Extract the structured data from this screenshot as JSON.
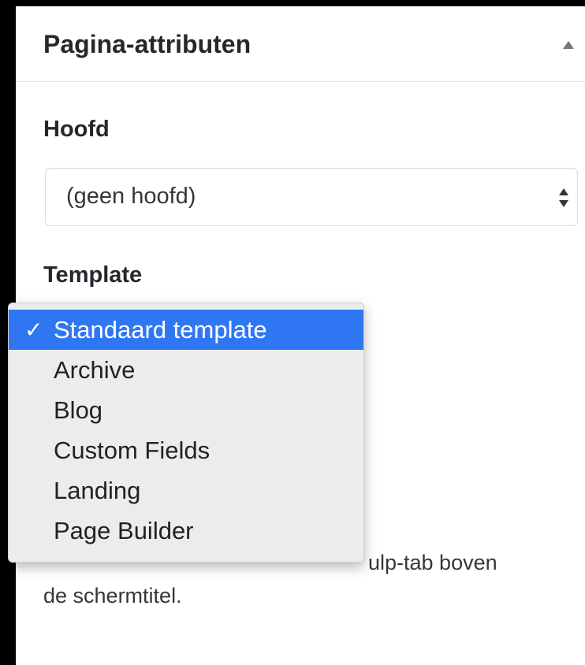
{
  "panel": {
    "title": "Pagina-attributen",
    "collapse_icon": "triangle-up-icon"
  },
  "parent": {
    "label": "Hoofd",
    "selected_value": "(geen hoofd)",
    "icon": "updown-arrows-icon"
  },
  "template": {
    "label": "Template",
    "check_mark": "✓",
    "options": [
      {
        "label": "Standaard template",
        "selected": true
      },
      {
        "label": "Archive",
        "selected": false
      },
      {
        "label": "Blog",
        "selected": false
      },
      {
        "label": "Custom Fields",
        "selected": false
      },
      {
        "label": "Landing",
        "selected": false
      },
      {
        "label": "Page Builder",
        "selected": false
      }
    ]
  },
  "help": {
    "line1": "ulp-tab boven",
    "line2": "de schermtitel."
  },
  "colors": {
    "selection": "#2f77f2",
    "background": "#000000",
    "panel": "#ffffff"
  }
}
